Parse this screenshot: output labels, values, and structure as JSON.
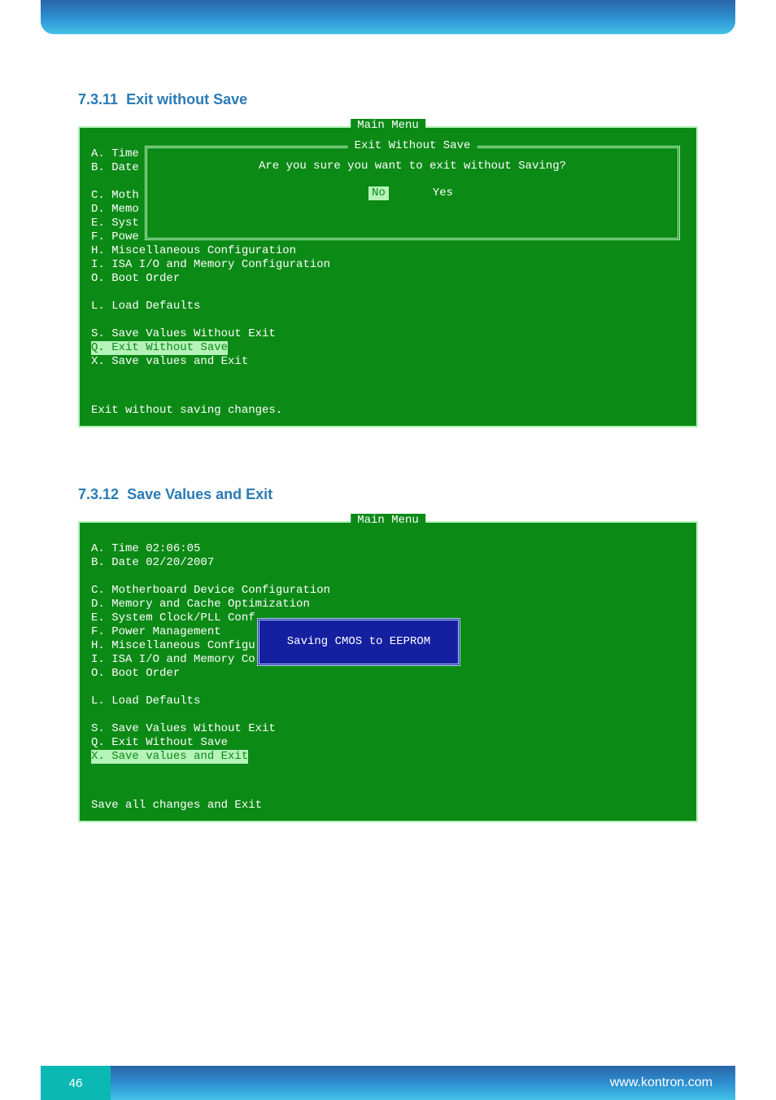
{
  "sections": {
    "s1": {
      "number": "7.3.11",
      "title": "Exit without Save"
    },
    "s2": {
      "number": "7.3.12",
      "title": "Save Values and Exit"
    }
  },
  "bios1": {
    "title": "Main Menu",
    "items": {
      "a": "A. Time",
      "b": "B. Date",
      "blank1": "",
      "c": "C. Moth",
      "d": "D. Memo",
      "e": "E. Syst",
      "f": "F. Powe",
      "h": "H. Miscellaneous Configuration",
      "i": "I. ISA I/O and Memory Configuration",
      "o": "O. Boot Order",
      "blank2": "",
      "l": "L. Load Defaults",
      "blank3": "",
      "s": "S. Save Values Without Exit",
      "q": "Q. Exit Without Save",
      "x": "X. Save values and Exit"
    },
    "status": "Exit without saving changes.",
    "popup": {
      "title": "Exit Without Save",
      "message": "Are you sure you want to exit without Saving?",
      "no": "No",
      "yes": "Yes"
    }
  },
  "bios2": {
    "title": "Main Menu",
    "items": {
      "a": "A. Time 02:06:05",
      "b": "B. Date 02/20/2007",
      "blank1": "",
      "c": "C. Motherboard Device Configuration",
      "d": "D. Memory and Cache Optimization",
      "e": "E. System Clock/PLL Conf",
      "f": "F. Power Management",
      "h": "H. Miscellaneous Configu",
      "i": "I. ISA I/O and Memory Co",
      "o": "O. Boot Order",
      "blank2": "",
      "l": "L. Load Defaults",
      "blank3": "",
      "s": "S. Save Values Without Exit",
      "q": "Q. Exit Without Save",
      "x": "X. Save values and Exit"
    },
    "status": "Save all changes and Exit",
    "popup": {
      "message": "Saving CMOS to EEPROM"
    }
  },
  "footer": {
    "page_number": "46",
    "url": "www.kontron.com"
  }
}
